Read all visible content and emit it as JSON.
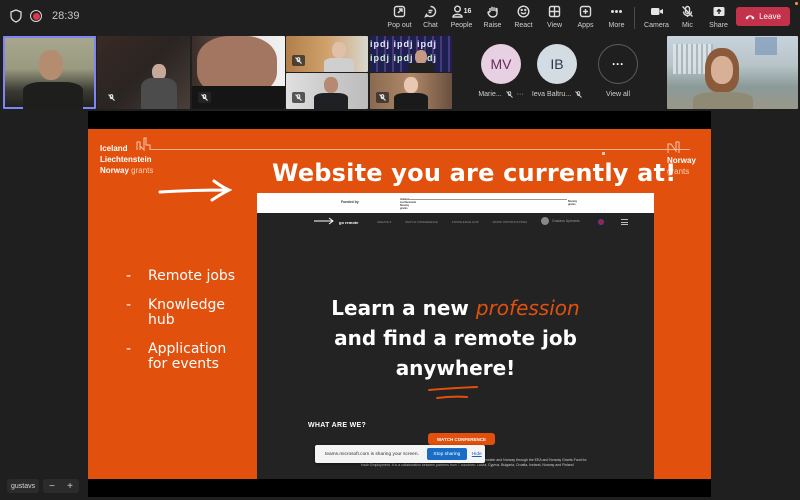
{
  "meeting": {
    "timer": "28:39",
    "recording": true
  },
  "toolbar": {
    "items": [
      {
        "id": "popout",
        "label": "Pop out",
        "icon": "popout-icon"
      },
      {
        "id": "chat",
        "label": "Chat",
        "icon": "chat-icon"
      },
      {
        "id": "people",
        "label": "People",
        "icon": "people-icon",
        "count": "16"
      },
      {
        "id": "raise",
        "label": "Raise",
        "icon": "hand-icon"
      },
      {
        "id": "react",
        "label": "React",
        "icon": "smiley-icon"
      },
      {
        "id": "view",
        "label": "View",
        "icon": "grid-icon"
      },
      {
        "id": "apps",
        "label": "Apps",
        "icon": "plus-square-icon"
      },
      {
        "id": "more",
        "label": "More",
        "icon": "ellipsis-icon"
      },
      {
        "id": "camera",
        "label": "Camera",
        "icon": "camera-icon"
      },
      {
        "id": "mic",
        "label": "Mic",
        "icon": "mic-off-icon"
      },
      {
        "id": "share",
        "label": "Share",
        "icon": "share-icon"
      }
    ],
    "leave_label": "Leave",
    "leave_color": "#c4314b"
  },
  "participants": {
    "avatars": [
      {
        "initials": "MV",
        "name": "Marie...",
        "bg": "#e7d0e1",
        "fg": "#6b2a5a",
        "muted": true,
        "has_more": true
      },
      {
        "initials": "IB",
        "name": "Ieva Baltru...",
        "bg": "#d3dbe3",
        "fg": "#2a3a4a",
        "muted": true,
        "has_more": false
      }
    ],
    "view_all_label": "View all",
    "view_all_icon": "ellipsis-icon"
  },
  "slide": {
    "logo_left": {
      "line1": "Iceland",
      "line2": "Liechtenstein",
      "line3": "Norway",
      "grants": "grants"
    },
    "logo_right": {
      "line1": "Norway",
      "grants": "grants"
    },
    "title": "Website you are currently at!",
    "bullets": [
      "Remote jobs",
      "Knowledge hub",
      "Application for events"
    ],
    "accent_color": "#e2500d"
  },
  "website": {
    "funded_by": "Funded by",
    "mini_logo_left": "Iceland Liechtenstein Norway grants",
    "mini_logo_right": "Norway grants",
    "brand": "go remote",
    "nav": [
      "CREATE ▾",
      "WATCH CONFERENCE",
      "KNOWLEDGE HUB",
      "WORK OPPORTUNITIES"
    ],
    "user_name": "Gustavs Upmanis",
    "hero_line1_a": "Learn a new ",
    "hero_line1_accent": "profession",
    "hero_line2": "and find a remote job",
    "hero_line3": "anywhere!",
    "section_heading": "WHAT ARE WE?",
    "watch_button": "WATCH CONFERENCE",
    "description_line1": "\"Go Remote\" platform is one of 4 international projects funded in 2021 by Iceland, Liechtenstein and Norway through the EEA and Norway Grants Fund for",
    "description_line2": "Youth Employment. It is a collaboration between partners from 7 countries: Latvia, Cyprus, Bulgaria, Croatia, Iceland, Norway and Finland"
  },
  "share_notice": {
    "text": "teams.microsoft.com is sharing your screen.",
    "stop_label": "Stop sharing",
    "hide_label": "Hide"
  },
  "footer": {
    "presenter_name": "gustavs",
    "zoom_out": "−",
    "zoom_in": "+"
  }
}
